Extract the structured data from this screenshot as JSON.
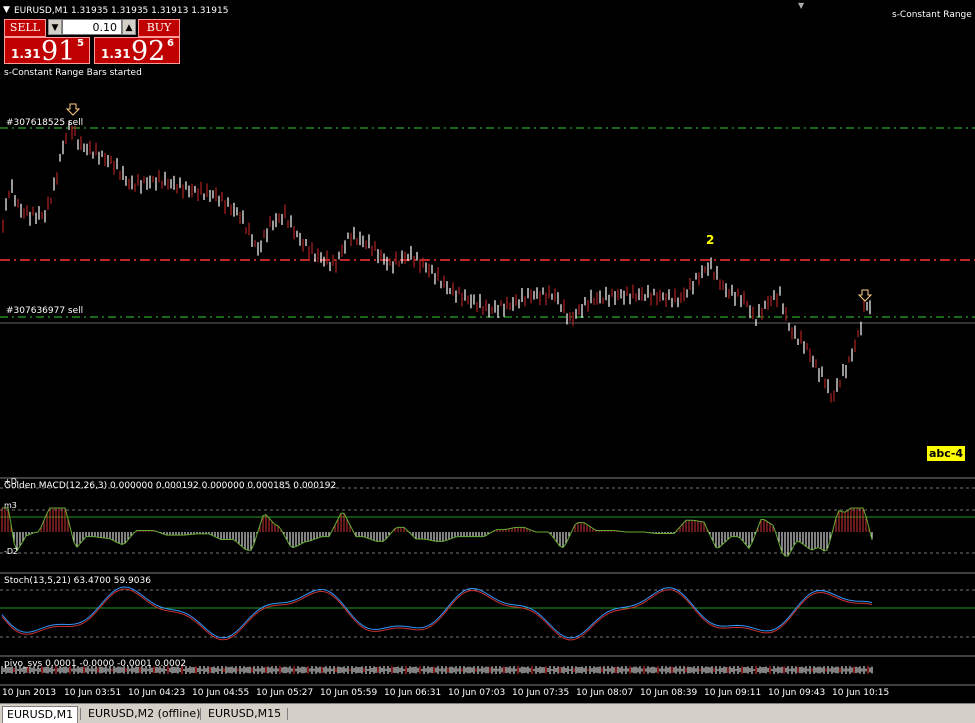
{
  "window": {
    "symbol_info": "EURUSD,M1  1.31935 1.31935 1.31913 1.31915",
    "indicator_name": "s-Constant Range B",
    "status_message": "s-Constant Range Bars started"
  },
  "trade_panel": {
    "sell_label": "SELL",
    "buy_label": "BUY",
    "lot_value": "0.10",
    "sell_price": {
      "prefix": "1.31",
      "big": "91",
      "sup": "5"
    },
    "buy_price": {
      "prefix": "1.31",
      "big": "92",
      "sup": "6"
    }
  },
  "orders": [
    {
      "label": "#307618525 sell"
    },
    {
      "label": "#307636977 sell"
    }
  ],
  "annotations": {
    "wave_label": "2",
    "abc_label": "abc-4"
  },
  "macd": {
    "title": "Golden MACD(12,26,3) 0.000000 0.000192 0.000000 0.000185 0.000192",
    "level_top": "+D",
    "level_m3": "m3",
    "level_bottom": "-D2"
  },
  "stoch": {
    "title": "Stoch(13,5,21) 63.4700 59.9036"
  },
  "pivot": {
    "title": "pivo_svs 0.0001 -0.0000 -0.0001 0.0002"
  },
  "time_axis": [
    "10 Jun 2013",
    "10 Jun 03:51",
    "10 Jun 04:23",
    "10 Jun 04:55",
    "10 Jun 05:27",
    "10 Jun 05:59",
    "10 Jun 06:31",
    "10 Jun 07:03",
    "10 Jun 07:35",
    "10 Jun 08:07",
    "10 Jun 08:39",
    "10 Jun 09:11",
    "10 Jun 09:43",
    "10 Jun 10:15"
  ],
  "tabs": [
    {
      "label": "EURUSD,M1",
      "active": true
    },
    {
      "label": "EURUSD,M2 (offline)",
      "active": false
    },
    {
      "label": "EURUSD,M15",
      "active": false
    }
  ],
  "colors": {
    "background": "#000000",
    "bull_bar": "#ffffff",
    "bear_bar": "#b22222",
    "order_line": "#33cc33",
    "resistance_line": "#ff3333",
    "macd_up": "#cc3333",
    "macd_down": "#66aa33",
    "stoch_main": "#3399ff",
    "stoch_signal": "#cc3333"
  },
  "icons": {
    "entry_arrow": "down-arrow-icon",
    "menu_icon": "menu-triangle-icon",
    "scroll_indicator": "chart-shift-icon"
  }
}
